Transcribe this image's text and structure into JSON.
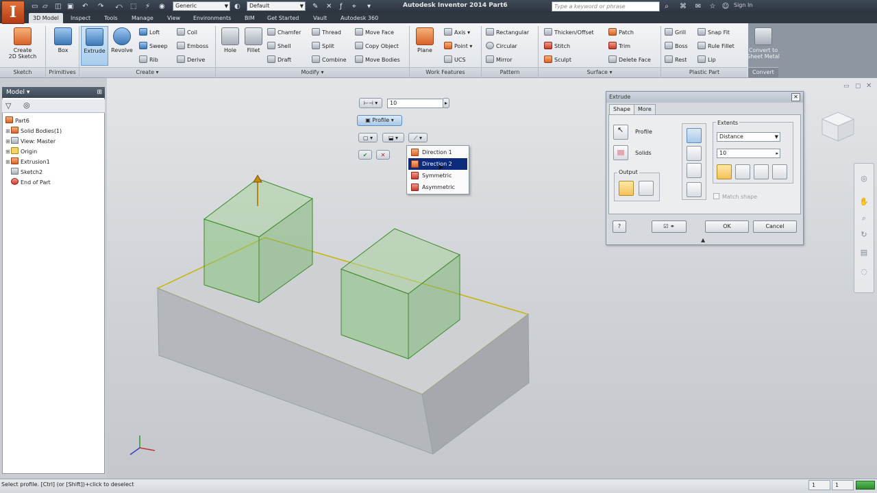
{
  "app": {
    "logo_letter": "I",
    "title": "Autodesk Inventor 2014    Part6",
    "search_placeholder": "Type a keyword or phrase",
    "signin": "Sign In"
  },
  "qat": {
    "material": "Generic",
    "appearance": "Default"
  },
  "ribbon_tabs": [
    "3D Model",
    "Inspect",
    "Tools",
    "Manage",
    "View",
    "Environments",
    "BIM",
    "Get Started",
    "Vault",
    "Autodesk 360"
  ],
  "ribbon": {
    "sketch": {
      "panel": "Sketch",
      "create_2d_sketch": "Create\n2D Sketch"
    },
    "primitives": {
      "panel": "Primitives",
      "box": "Box"
    },
    "create": {
      "panel": "Create ▾",
      "extrude": "Extrude",
      "revolve": "Revolve",
      "loft": "Loft",
      "sweep": "Sweep",
      "rib": "Rib",
      "coil": "Coil",
      "emboss": "Emboss",
      "derive": "Derive"
    },
    "modify": {
      "panel": "Modify ▾",
      "hole": "Hole",
      "fillet": "Fillet",
      "chamfer": "Chamfer",
      "shell": "Shell",
      "draft": "Draft",
      "thread": "Thread",
      "split": "Split",
      "combine": "Combine",
      "move_face": "Move Face",
      "copy_object": "Copy Object",
      "move_bodies": "Move Bodies"
    },
    "work_features": {
      "panel": "Work Features",
      "plane": "Plane",
      "axis": "Axis",
      "point": "Point",
      "ucs": "UCS"
    },
    "pattern": {
      "panel": "Pattern",
      "rectangular": "Rectangular",
      "circular": "Circular",
      "mirror": "Mirror"
    },
    "surface": {
      "panel": "Surface ▾",
      "thicken_offset": "Thicken/Offset",
      "stitch": "Stitch",
      "sculpt": "Sculpt",
      "patch": "Patch",
      "trim": "Trim",
      "delete_face": "Delete Face"
    },
    "plastic_part": {
      "panel": "Plastic Part",
      "grill": "Grill",
      "boss": "Boss",
      "rest": "Rest",
      "snap_fit": "Snap Fit",
      "rule_fillet": "Rule Fillet",
      "lip": "Lip"
    },
    "convert": {
      "panel": "Convert",
      "convert_to_sheet_metal": "Convert to\nSheet Metal"
    }
  },
  "browser": {
    "header": "Model ▾",
    "items": [
      {
        "label": "Part6",
        "level": 0,
        "icon": "part-icon"
      },
      {
        "label": "Solid Bodies(1)",
        "level": 1,
        "icon": "solid-bodies-icon"
      },
      {
        "label": "View: Master",
        "level": 1,
        "icon": "view-icon"
      },
      {
        "label": "Origin",
        "level": 1,
        "icon": "folder-icon"
      },
      {
        "label": "Extrusion1",
        "level": 1,
        "icon": "extrusion-icon"
      },
      {
        "label": "Sketch2",
        "level": 1,
        "icon": "sketch-icon"
      },
      {
        "label": "End of Part",
        "level": 1,
        "icon": "end-of-part-icon"
      }
    ]
  },
  "minitoolbar": {
    "distance_value": "10",
    "profile_label": "Profile",
    "direction_menu": [
      "Direction 1",
      "Direction 2",
      "Symmetric",
      "Asymmetric"
    ],
    "direction_selected_index": 1
  },
  "dialog": {
    "title": "Extrude",
    "tabs": [
      "Shape",
      "More"
    ],
    "profile_label": "Profile",
    "solids_label": "Solids",
    "output_label": "Output",
    "extents_label": "Extents",
    "extents_type": "Distance",
    "distance_value": "10",
    "match_shape": "Match shape",
    "ok": "OK",
    "cancel": "Cancel"
  },
  "status": {
    "text": "Select profile. [Ctrl] (or [Shift])+click to deselect",
    "count1": "1",
    "count2": "1"
  },
  "colors": {
    "accent_blue": "#0d2b7a",
    "preview_green": "#86c27a",
    "selected_edge": "#c8b400"
  }
}
